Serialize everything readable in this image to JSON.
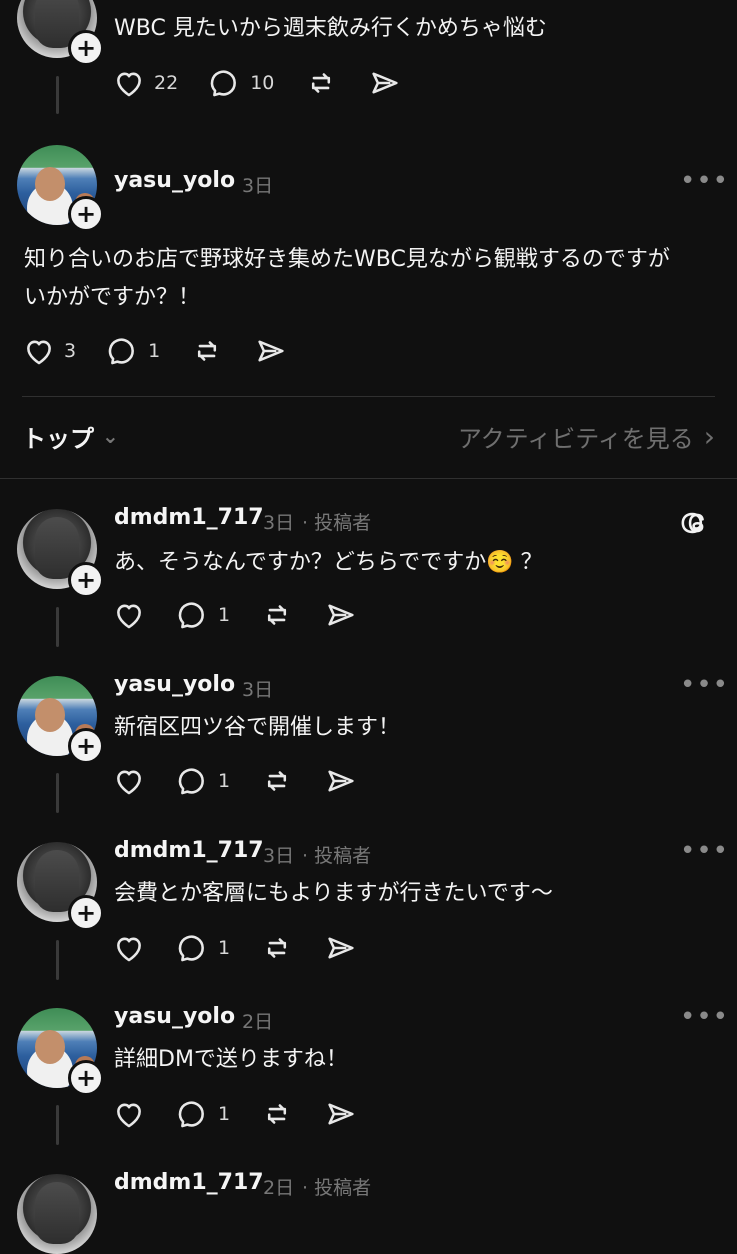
{
  "posts": [
    {
      "avatar": "dm",
      "text": "WBC 見たいから週末飲み行くかめちゃ悩む",
      "likes": "22",
      "replies": "10"
    },
    {
      "avatar": "yasu",
      "name": "yasu_yolo",
      "time": "3日",
      "text_line1": "知り合いのお店で野球好き集めたWBC見ながら観戦するのですが",
      "text_line2": "いかがですか？！",
      "likes": "3",
      "replies": "1"
    }
  ],
  "section": {
    "top_label": "トップ",
    "activity_label": "アクティビティを見る"
  },
  "replies": [
    {
      "avatar": "dm",
      "name": "dmdm1_717",
      "time": "3日",
      "role": "· 投稿者",
      "text": "あ、そうなんですか？どちらでですか☺️ ？",
      "replies": "1"
    },
    {
      "avatar": "yasu",
      "name": "yasu_yolo",
      "time": "3日",
      "text": "新宿区四ツ谷で開催します！",
      "replies": "1"
    },
    {
      "avatar": "dm",
      "name": "dmdm1_717",
      "time": "3日",
      "role": "· 投稿者",
      "text": "会費とか客層にもよりますが行きたいです〜",
      "replies": "1"
    },
    {
      "avatar": "yasu",
      "name": "yasu_yolo",
      "time": "2日",
      "text": "詳細DMで送りますね！",
      "replies": "1"
    },
    {
      "avatar": "dm",
      "name": "dmdm1_717",
      "time": "2日",
      "role": "· 投稿者"
    }
  ],
  "icons": {
    "like": "heart-icon",
    "reply": "comment-icon",
    "repost": "repost-icon",
    "share": "send-icon",
    "more": "more-icon",
    "brand": "threads-icon"
  }
}
